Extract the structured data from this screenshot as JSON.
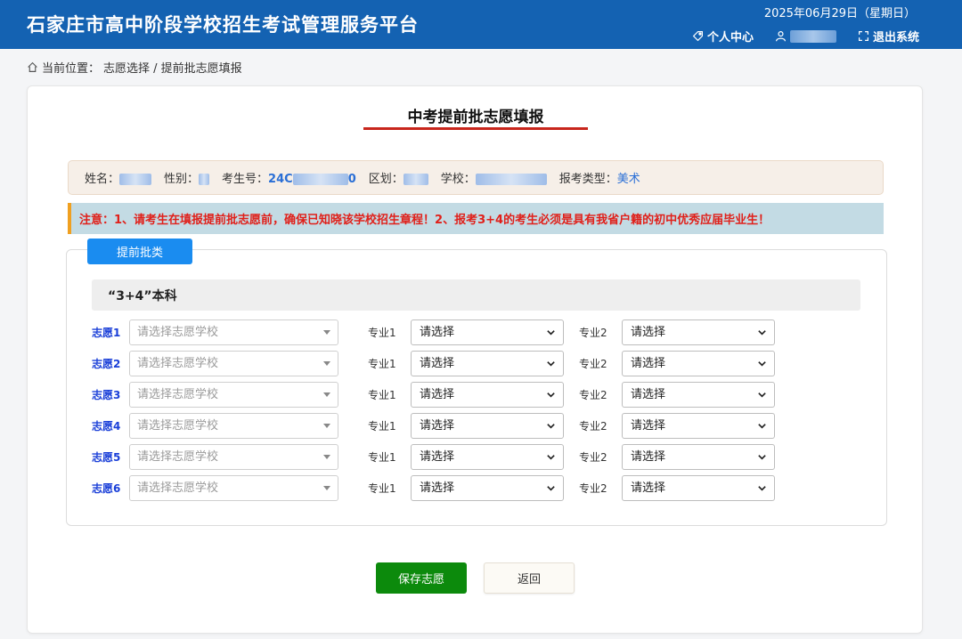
{
  "header": {
    "title": "石家庄市高中阶段学校招生考试管理服务平台",
    "date": "2025年06月29日（星期日）",
    "personal_center": "个人中心",
    "logout": "退出系统"
  },
  "breadcrumb": {
    "prefix": "当前位置：",
    "path": "志愿选择 / 提前批志愿填报"
  },
  "page_title": "中考提前批志愿填报",
  "student_info": {
    "name_label": "姓名：",
    "gender_label": "性别：",
    "exam_no_label": "考生号：",
    "exam_no_prefix": "24C",
    "exam_no_suffix": "0",
    "district_label": "区划：",
    "school_label": "学校：",
    "category_label": "报考类型：",
    "category_value": "美术"
  },
  "notice": "注意：1、请考生在填报提前批志愿前，确保已知晓该学校招生章程！2、报考3+4的考生必须是具有我省户籍的初中优秀应届毕业生！",
  "tab_label": "提前批类",
  "section_title": "“3+4”本科",
  "wish_rows": [
    {
      "label": "志愿1",
      "school_placeholder": "请选择志愿学校",
      "major1_label": "专业1",
      "major1_value": "请选择",
      "major2_label": "专业2",
      "major2_value": "请选择"
    },
    {
      "label": "志愿2",
      "school_placeholder": "请选择志愿学校",
      "major1_label": "专业1",
      "major1_value": "请选择",
      "major2_label": "专业2",
      "major2_value": "请选择"
    },
    {
      "label": "志愿3",
      "school_placeholder": "请选择志愿学校",
      "major1_label": "专业1",
      "major1_value": "请选择",
      "major2_label": "专业2",
      "major2_value": "请选择"
    },
    {
      "label": "志愿4",
      "school_placeholder": "请选择志愿学校",
      "major1_label": "专业1",
      "major1_value": "请选择",
      "major2_label": "专业2",
      "major2_value": "请选择"
    },
    {
      "label": "志愿5",
      "school_placeholder": "请选择志愿学校",
      "major1_label": "专业1",
      "major1_value": "请选择",
      "major2_label": "专业2",
      "major2_value": "请选择"
    },
    {
      "label": "志愿6",
      "school_placeholder": "请选择志愿学校",
      "major1_label": "专业1",
      "major1_value": "请选择",
      "major2_label": "专业2",
      "major2_value": "请选择"
    }
  ],
  "buttons": {
    "save": "保存志愿",
    "back": "返回"
  },
  "colors": {
    "header_bg": "#1462b2",
    "accent_blue": "#1a8cf0",
    "save_green": "#0c8a0c",
    "notice_red": "#e0201a",
    "title_underline": "#c8261c"
  },
  "icons": {
    "personal_center": "tag-icon",
    "user": "user-icon",
    "logout": "expand-icon",
    "breadcrumb": "home-icon"
  }
}
